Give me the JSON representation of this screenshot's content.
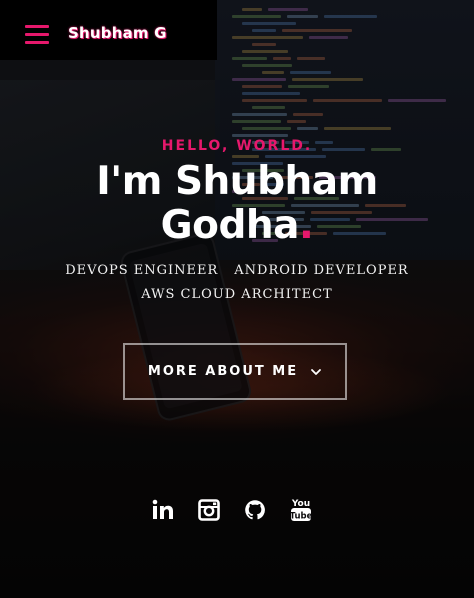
{
  "header": {
    "brand": "Shubham G",
    "menu_icon": "hamburger-menu-icon"
  },
  "hero": {
    "greeting": "HELLO, WORLD.",
    "title_line1": "I'm Shubham",
    "title_line2": "Godha",
    "title_dot": ".",
    "roles": [
      "DEVOPS ENGINEER",
      "ANDROID DEVELOPER",
      "AWS CLOUD ARCHITECT"
    ],
    "cta_label": "MORE ABOUT ME",
    "cta_icon": "chevron-down-icon"
  },
  "social": [
    {
      "name": "linkedin",
      "icon": "linkedin-icon"
    },
    {
      "name": "instagram",
      "icon": "instagram-icon"
    },
    {
      "name": "github",
      "icon": "github-icon"
    },
    {
      "name": "youtube",
      "icon": "youtube-icon"
    }
  ],
  "colors": {
    "accent": "#e6186c",
    "header_bg": "#000000",
    "text": "#ffffff"
  }
}
